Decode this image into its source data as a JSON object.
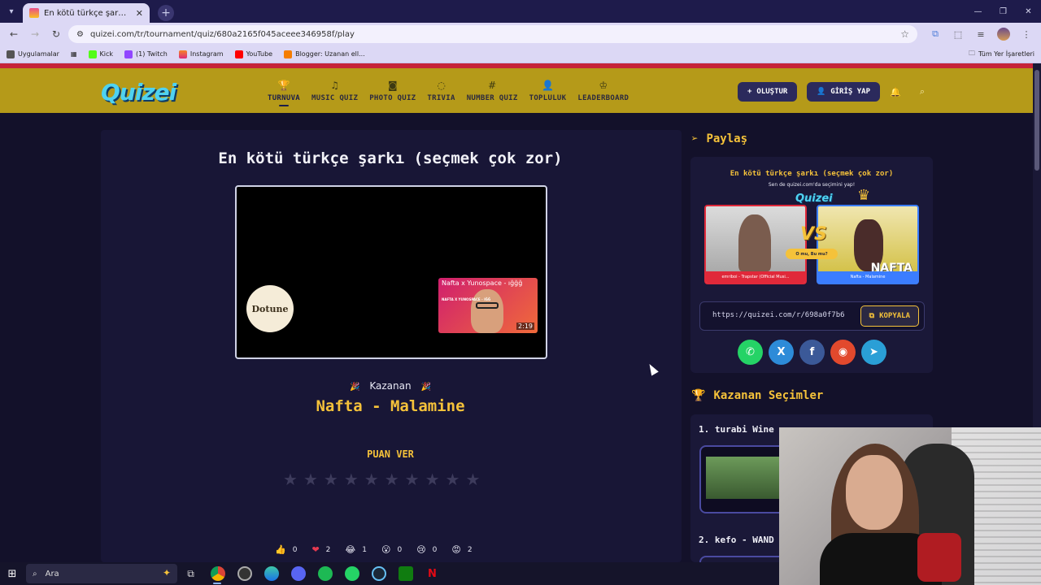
{
  "browser": {
    "tab_title": "En kötü türkçe şarkı (seçmek ço",
    "url": "quizei.com/tr/tournament/quiz/680a2165f045aceee346958f/play",
    "bookmarks": [
      "Uygulamalar",
      "Kick",
      "(1) Twitch",
      "Instagram",
      "YouTube",
      "Blogger: Uzanan ell..."
    ],
    "bookmarks_right": "Tüm Yer İşaretleri"
  },
  "header": {
    "logo": "Quizei",
    "nav": [
      {
        "label": "TURNUVA",
        "icon": "trophy-icon",
        "active": true
      },
      {
        "label": "MUSIC QUIZ",
        "icon": "music-note-icon"
      },
      {
        "label": "PHOTO QUIZ",
        "icon": "camera-icon"
      },
      {
        "label": "TRIVIA",
        "icon": "chat-question-icon"
      },
      {
        "label": "NUMBER QUIZ",
        "icon": "hash-icon"
      },
      {
        "label": "TOPLULUK",
        "icon": "people-icon"
      },
      {
        "label": "LEADERBOARD",
        "icon": "badge-icon"
      }
    ],
    "create_label": "OLUŞTUR",
    "login_label": "GİRİŞ YAP"
  },
  "quiz": {
    "title": "En kötü türkçe şarkı (seçmek çok zor)",
    "video": {
      "channel_logo_text": "Dotune",
      "next_title": "Nafta x Yunospace - ığğğ",
      "next_sub": "NAFTA X YUNOSPACE - IĞĞ",
      "next_duration": "2:19"
    },
    "winner_label": "Kazanan",
    "winner_name": "Nafta - Malamine",
    "rate_label": "PUAN VER",
    "star_count": 10,
    "reactions": [
      {
        "emoji": "👍",
        "count": "0"
      },
      {
        "emoji": "❤",
        "count": "2"
      },
      {
        "emoji": "😂",
        "count": "1"
      },
      {
        "emoji": "😮",
        "count": "0"
      },
      {
        "emoji": "😢",
        "count": "0"
      },
      {
        "emoji": "😡",
        "count": "2"
      }
    ]
  },
  "share": {
    "title": "Paylaş",
    "card_title": "En kötü türkçe şarkı (seçmek çok zor)",
    "card_subtitle": "Sen de quizei.com'da seçimini yap!",
    "card_logo": "Quizei",
    "left_caption": "emriboi - Trapstar (Official Musi...",
    "right_caption": "Nafta - Malamine",
    "right_brand": "NAFTA",
    "vs": "VS",
    "vs_pill": "O mu, Bu mu?",
    "link": "https://quizei.com/r/698a0f7b6",
    "copy_label": "KOPYALA",
    "socials": [
      {
        "name": "whatsapp-icon",
        "glyph": "✆",
        "color": "#25d366"
      },
      {
        "name": "x-icon",
        "glyph": "X",
        "color": "#2d8bd8"
      },
      {
        "name": "facebook-icon",
        "glyph": "f",
        "color": "#3b5998"
      },
      {
        "name": "reddit-icon",
        "glyph": "◉",
        "color": "#e2492d"
      },
      {
        "name": "telegram-icon",
        "glyph": "➤",
        "color": "#2a9fd6"
      }
    ]
  },
  "winners": {
    "title": "Kazanan Seçimler",
    "items": [
      "1. turabi Wine",
      "2. kefo - WAND"
    ]
  },
  "taskbar": {
    "search_label": "Ara"
  }
}
